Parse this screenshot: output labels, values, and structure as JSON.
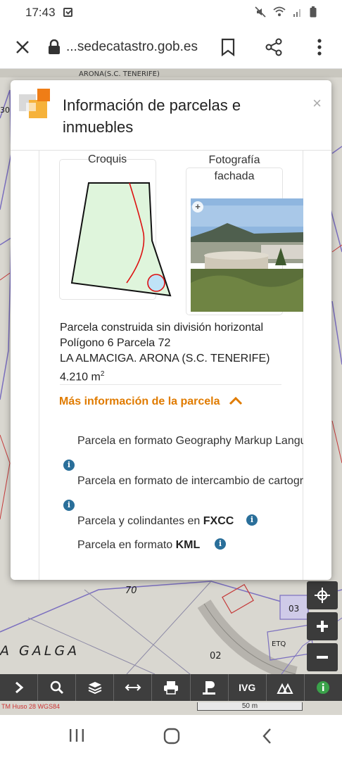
{
  "status_bar": {
    "time": "17:43",
    "icons": [
      "notification-icon",
      "mute-icon",
      "wifi-icon",
      "signal-icon",
      "battery-icon"
    ]
  },
  "browser": {
    "url": "...sedecatastro.gob.es",
    "icons": [
      "close-icon",
      "lock-icon",
      "bookmark-icon",
      "share-icon",
      "more-icon"
    ]
  },
  "map": {
    "top_label": "ARONA(S.C. TENERIFE)",
    "labels": {
      "l30": "30",
      "l70": "70",
      "l02": "02",
      "galga": "A GALGA",
      "etq": "ETQ",
      "l03": "03"
    },
    "toolbar": [
      "chevron-right-icon",
      "search-icon",
      "layers-icon",
      "measure-icon",
      "print-icon",
      "parcel-icon",
      "IVG",
      "buildings-icon",
      "info-icon"
    ],
    "toolbar_ivg_label": "IVG",
    "projection": "TM Huso 28 WGS84",
    "scale": "50 m"
  },
  "modal": {
    "title": "Información de parcelas e inmuebles",
    "close_glyph": "×",
    "croquis_label": "Croquis",
    "foto_label_1": "Fotografía",
    "foto_label_2": "fachada",
    "parcel_type": "Parcela construida sin división horizontal",
    "polygon": "Polígono 6 Parcela 72",
    "location": "LA ALMACIGA. ARONA (S.C. TENERIFE)",
    "area_value": "4.210 m",
    "area_sup": "2",
    "more_info": "Más información de la parcela",
    "links": {
      "gml": "Parcela en formato Geography Markup Language",
      "intercambio": "Parcela en formato de intercambio de cartografía",
      "fxcc_prefix": "Parcela y colindantes en ",
      "fxcc_bold": "FXCC",
      "kml_prefix": "Parcela en formato ",
      "kml_bold": "KML"
    }
  },
  "colors": {
    "accent_orange": "#e07b00",
    "info_blue": "#2a6f9a",
    "toolbar_dark": "#3e3e3e"
  }
}
